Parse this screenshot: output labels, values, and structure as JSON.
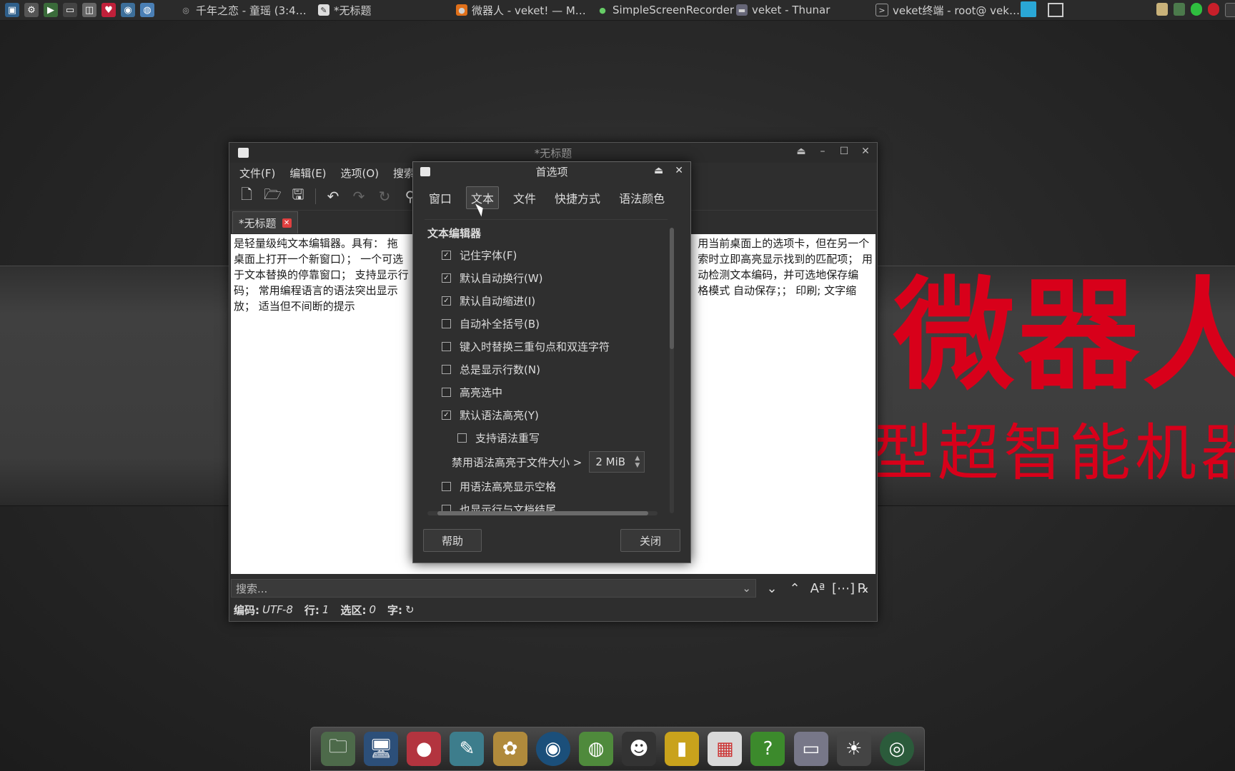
{
  "taskbar": {
    "tasks": [
      {
        "label": "千年之恋 - 童瑶 (3:4…"
      },
      {
        "label": "*无标题"
      },
      {
        "label": "微器人 - veket! — M…"
      },
      {
        "label": "SimpleScreenRecorder"
      },
      {
        "label": "veket - Thunar"
      },
      {
        "label": "veket终端 - root@ vek…"
      }
    ],
    "launcher_icons": [
      "system-monitor-icon",
      "settings-icon",
      "play-icon",
      "terminal-icon",
      "screenshot-icon",
      "heart-icon",
      "network-icon",
      "browser-icon"
    ],
    "tray_icons": [
      "clipboard-icon",
      "network-tray-icon",
      "battery-icon",
      "record-icon",
      "power-icon"
    ]
  },
  "wallpaper": {
    "big_text": "微器人",
    "small_text": "型超智能机器",
    "text_color": "#d8001a"
  },
  "editor_window": {
    "title": "*无标题",
    "menu": {
      "file": "文件(F)",
      "edit": "编辑(E)",
      "options": "选项(O)",
      "search": "搜索"
    },
    "tab_label": "*无标题",
    "content_lines": [
      "是轻量级纯文本编辑器。具有： 拖",
      "桌面上打开一个新窗口）； 一个可选",
      "于文本替换的停靠窗口； 支持显示行",
      "码； 常用编程语言的语法突出显示",
      "放； 适当但不间断的提示"
    ],
    "content_right_lines": [
      "用当前桌面上的选项卡，但在另一个",
      "索时立即高亮显示找到的匹配项； 用",
      "动检测文本编码，并可选地保存编",
      "格模式 自动保存；； 印刷; 文字缩",
      ""
    ],
    "search_placeholder": "搜索...",
    "status": {
      "encoding_label": "编码:",
      "encoding_value": "UTF-8",
      "line_label": "行:",
      "line_value": "1",
      "selection_label": "选区:",
      "selection_value": "0",
      "chars_label": "字:"
    }
  },
  "preferences_dialog": {
    "title": "首选项",
    "tabs": [
      "窗口",
      "文本",
      "文件",
      "快捷方式",
      "语法颜色"
    ],
    "active_tab": "文本",
    "section_title": "文本编辑器",
    "options": [
      {
        "label": "记住字体(F)",
        "checked": true
      },
      {
        "label": "默认自动换行(W)",
        "checked": true
      },
      {
        "label": "默认自动缩进(I)",
        "checked": true
      },
      {
        "label": "自动补全括号(B)",
        "checked": false
      },
      {
        "label": "键入时替换三重句点和双连字符",
        "checked": false
      },
      {
        "label": "总是显示行数(N)",
        "checked": false
      },
      {
        "label": "高亮选中",
        "checked": false
      },
      {
        "label": "默认语法高亮(Y)",
        "checked": true
      }
    ],
    "sub_option": {
      "label": "支持语法重写",
      "checked": false
    },
    "size_limit_label": "禁用语法高亮于文件大小 >",
    "size_limit_value": "2 MiB",
    "options_after": [
      {
        "label": "用语法高亮显示空格",
        "checked": false
      },
      {
        "label": "也显示行与文档结尾",
        "checked": false
      }
    ],
    "help_button": "帮助",
    "close_button": "关闭"
  },
  "dock": {
    "items": [
      "file-manager-icon",
      "computer-icon",
      "veket-mascot-icon",
      "text-editor-icon",
      "paint-icon",
      "media-icon",
      "network-globe-icon",
      "qq-penguin-icon",
      "notebook-icon",
      "presentation-icon",
      "help-icon",
      "drive-icon",
      "brightness-icon",
      "camera-icon"
    ]
  },
  "colors": {
    "editor_bg": "#ffffff",
    "window_bg": "#2e2e2e",
    "accent_red": "#d8001a"
  }
}
